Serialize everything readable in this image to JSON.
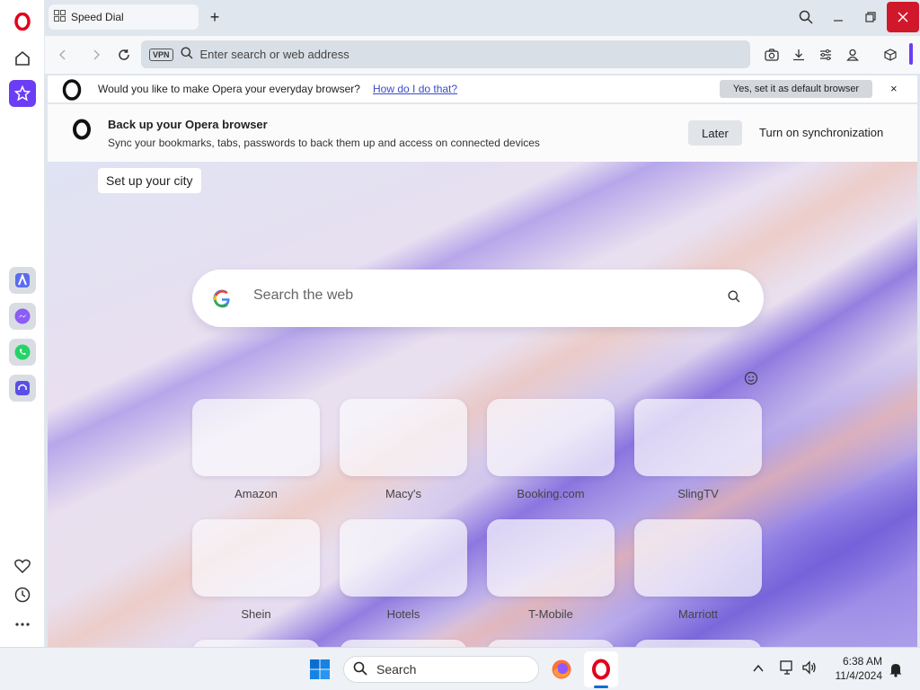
{
  "tab": {
    "title": "Speed Dial"
  },
  "address_bar": {
    "placeholder": "Enter search or web address",
    "vpn_label": "VPN"
  },
  "infobar": {
    "message": "Would you like to make Opera your everyday browser?",
    "link": "How do I do that?",
    "button": "Yes, set it as default browser",
    "close": "×"
  },
  "sync": {
    "title": "Back up your Opera browser",
    "subtitle": "Sync your bookmarks, tabs, passwords to back them up and access on connected devices",
    "later": "Later",
    "turn_on": "Turn on synchronization"
  },
  "speed_dial": {
    "city_label": "Set up your city",
    "search_placeholder": "Search the web",
    "tiles": [
      "Amazon",
      "Macy's",
      "Booking.com",
      "SlingTV",
      "Shein",
      "Hotels",
      "T-Mobile",
      "Marriott"
    ]
  },
  "taskbar": {
    "search_label": "Search",
    "time": "6:38 AM",
    "date": "11/4/2024"
  },
  "colors": {
    "opera_red": "#e2001a",
    "accent_purple": "#6b3df5",
    "close_red": "#d1182b"
  }
}
